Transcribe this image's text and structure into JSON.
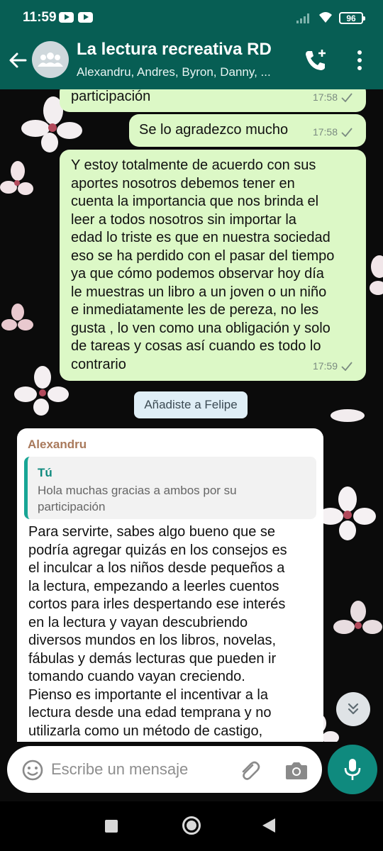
{
  "status_bar": {
    "time": "11:59",
    "battery": "96"
  },
  "header": {
    "title": "La lectura recreativa RD",
    "subtitle": "Alexandru, Andres, Byron, Danny, ..."
  },
  "messages": [
    {
      "direction": "outgoing",
      "text": "participación",
      "time": "17:58",
      "status": "delivered"
    },
    {
      "direction": "outgoing",
      "text": "Se lo agradezco mucho",
      "time": "17:58",
      "status": "delivered"
    },
    {
      "direction": "outgoing",
      "lines": [
        "Y estoy totalmente de acuerdo con sus",
        "aportes nosotros debemos tener en",
        "cuenta la importancia que nos brinda el",
        "leer a todos nosotros sin importar la",
        "edad lo triste es que en nuestra sociedad",
        "eso se ha perdido con el pasar del tiempo",
        "ya que cómo podemos observar hoy día",
        "le muestras un libro a un joven o un niño",
        "e inmediatamente les de pereza, no les",
        "gusta , lo ven como una obligación y solo",
        "de tareas y cosas así cuando es todo lo",
        "contrario"
      ],
      "time": "17:59",
      "status": "delivered"
    }
  ],
  "system_message": "Añadiste a Felipe",
  "incoming": {
    "sender": "Alexandru",
    "quote": {
      "author": "Tú",
      "lines": [
        "Hola muchas gracias a ambos por su",
        "participación"
      ]
    },
    "lines": [
      "Para servirte, sabes algo bueno que se",
      "podría agregar quizás en los consejos es",
      "el inculcar a los niños desde pequeños a",
      "la lectura, empezando a leerles cuentos",
      "cortos para irles despertando ese interés",
      "en la lectura y vayan descubriendo",
      "diversos mundos en los libros, novelas,",
      "fábulas y demás lecturas que pueden ir",
      "tomando cuando vayan creciendo.",
      "Pienso es importante el incentivar a la",
      "lectura desde una edad temprana y no",
      "utilizarla como un método de castigo,"
    ]
  },
  "input": {
    "placeholder": "Escribe un mensaje"
  },
  "colors": {
    "header": "#075e54",
    "outgoing_bubble": "#dcf8c6",
    "incoming_bubble": "#ffffff",
    "accent": "#0f8a7e",
    "sender_name": "#a9795b"
  },
  "icons": {
    "back": "arrow-left-icon",
    "group_avatar": "group-icon",
    "call": "add-call-icon",
    "menu": "more-vert-icon",
    "tick": "check-icon",
    "scroll": "double-chevron-down-icon",
    "emoji": "smiley-icon",
    "attach": "paperclip-icon",
    "camera": "camera-icon",
    "mic": "microphone-icon"
  }
}
